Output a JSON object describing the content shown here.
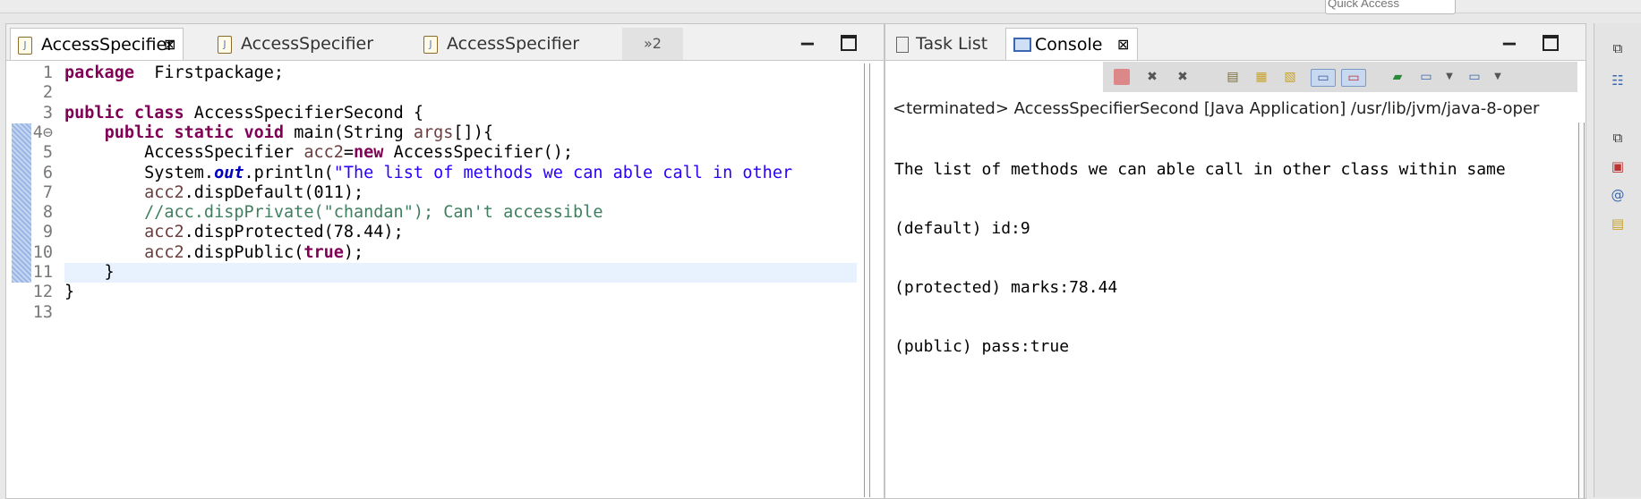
{
  "top": {
    "quick_access_placeholder": "Quick Access"
  },
  "editor": {
    "tabs": [
      {
        "label": "AccessSpecifier",
        "active": true
      },
      {
        "label": "AccessSpecifier",
        "active": false
      },
      {
        "label": "AccessSpecifier",
        "active": false
      }
    ],
    "overflow_label": "»2",
    "lines": [
      {
        "num": "1",
        "tokens": [
          [
            "kw",
            "package"
          ],
          [
            "",
            "  Firstpackage;"
          ]
        ]
      },
      {
        "num": "2",
        "tokens": []
      },
      {
        "num": "3",
        "tokens": [
          [
            "kw",
            "public"
          ],
          [
            "",
            " "
          ],
          [
            "kw",
            "class"
          ],
          [
            "",
            " AccessSpecifierSecond {"
          ]
        ]
      },
      {
        "num": "4⊖",
        "tokens": [
          [
            "",
            "    "
          ],
          [
            "kw",
            "public"
          ],
          [
            "",
            " "
          ],
          [
            "kw",
            "static"
          ],
          [
            "",
            " "
          ],
          [
            "kw",
            "void"
          ],
          [
            "",
            " main(String "
          ],
          [
            "var",
            "args"
          ],
          [
            "",
            "[]){"
          ]
        ]
      },
      {
        "num": "5",
        "tokens": [
          [
            "",
            "        AccessSpecifier "
          ],
          [
            "var",
            "acc2"
          ],
          [
            "",
            "="
          ],
          [
            "kw",
            "new"
          ],
          [
            "",
            " AccessSpecifier();"
          ]
        ]
      },
      {
        "num": "6",
        "tokens": [
          [
            "",
            "        System."
          ],
          [
            "fld",
            "out"
          ],
          [
            "",
            ".println("
          ],
          [
            "str",
            "\"The list of methods we can able call in other "
          ]
        ]
      },
      {
        "num": "7",
        "tokens": [
          [
            "",
            "        "
          ],
          [
            "var",
            "acc2"
          ],
          [
            "",
            ".dispDefault(011);"
          ]
        ]
      },
      {
        "num": "8",
        "tokens": [
          [
            "",
            "        "
          ],
          [
            "cmt",
            "//acc.dispPrivate(\"chandan\"); Can't accessible"
          ]
        ]
      },
      {
        "num": "9",
        "tokens": [
          [
            "",
            "        "
          ],
          [
            "var",
            "acc2"
          ],
          [
            "",
            ".dispProtected(78.44);"
          ]
        ]
      },
      {
        "num": "10",
        "tokens": [
          [
            "",
            "        "
          ],
          [
            "var",
            "acc2"
          ],
          [
            "",
            ".dispPublic("
          ],
          [
            "kw",
            "true"
          ],
          [
            "",
            ");"
          ]
        ]
      },
      {
        "num": "11",
        "tokens": [
          [
            "",
            "    }"
          ]
        ]
      },
      {
        "num": "12",
        "tokens": [
          [
            "",
            "}"
          ]
        ]
      },
      {
        "num": "13",
        "tokens": []
      }
    ]
  },
  "console": {
    "tabs": [
      {
        "label": "Task List"
      },
      {
        "label": "Console"
      }
    ],
    "header": "<terminated> AccessSpecifierSecond [Java Application] /usr/lib/jvm/java-8-oper",
    "output": [
      "The list of methods we can able call in other class within same",
      "(default) id:9",
      "(protected) marks:78.44",
      "(public) pass:true"
    ]
  },
  "colors": {
    "keyword": "#7f0055",
    "string": "#2a00ff",
    "comment": "#3f7f5f",
    "field": "#0000c0",
    "current_line": "#e8f2fe"
  }
}
